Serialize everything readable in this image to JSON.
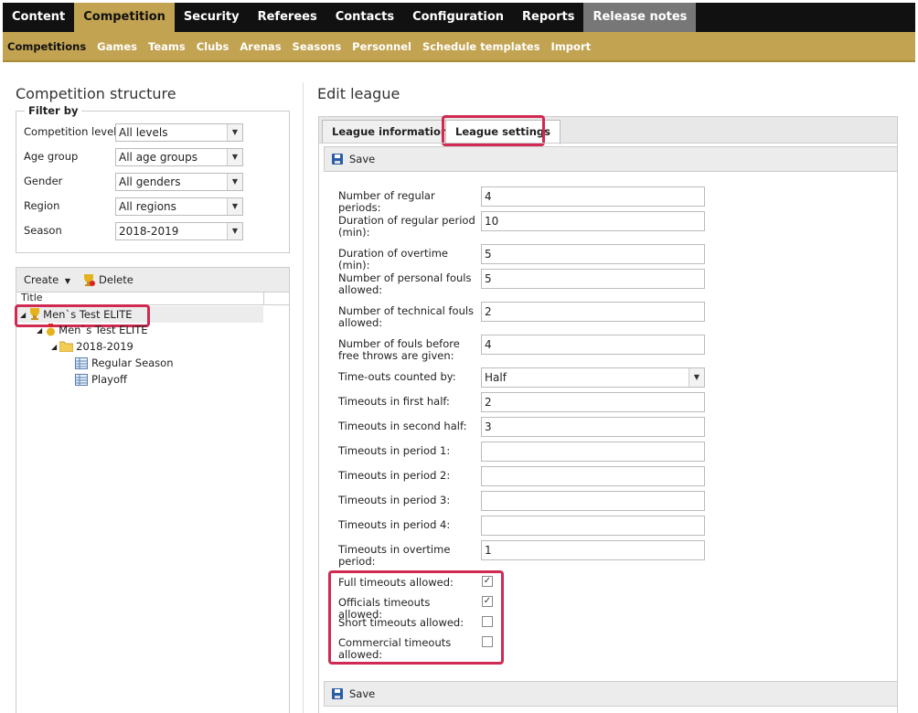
{
  "topnav": [
    "Content",
    "Competition",
    "Security",
    "Referees",
    "Contacts",
    "Configuration",
    "Reports",
    "Release notes"
  ],
  "subnav": [
    "Competitions",
    "Games",
    "Teams",
    "Clubs",
    "Arenas",
    "Seasons",
    "Personnel",
    "Schedule templates",
    "Import"
  ],
  "left": {
    "title": "Competition structure",
    "filter": {
      "legend": "Filter by",
      "rows": [
        {
          "label": "Competition level",
          "value": "All levels"
        },
        {
          "label": "Age group",
          "value": "All age groups"
        },
        {
          "label": "Gender",
          "value": "All genders"
        },
        {
          "label": "Region",
          "value": "All regions"
        },
        {
          "label": "Season",
          "value": "2018-2019"
        }
      ]
    },
    "toolbar": {
      "create": "Create",
      "delete": "Delete"
    },
    "tree_header": "Title",
    "tree": {
      "root": "Men`s Test ELITE",
      "child": "Men`s Test ELITE",
      "season": "2018-2019",
      "leaf1": "Regular Season",
      "leaf2": "Playoff"
    }
  },
  "right": {
    "title": "Edit league",
    "tabs": [
      "League information",
      "League settings"
    ],
    "save": "Save",
    "fields": [
      {
        "label": "Number of regular periods:",
        "value": "4"
      },
      {
        "label": "Duration of regular period (min):",
        "value": "10"
      },
      {
        "label": "Duration of overtime (min):",
        "value": "5"
      },
      {
        "label": "Number of personal fouls allowed:",
        "value": "5"
      },
      {
        "label": "Number of technical fouls allowed:",
        "value": "2"
      },
      {
        "label": "Number of fouls before free throws are given:",
        "value": "4"
      },
      {
        "label": "Time-outs counted by:",
        "value": "Half"
      },
      {
        "label": "Timeouts in first half:",
        "value": "2"
      },
      {
        "label": "Timeouts in second half:",
        "value": "3"
      },
      {
        "label": "Timeouts in period 1:",
        "value": ""
      },
      {
        "label": "Timeouts in period 2:",
        "value": ""
      },
      {
        "label": "Timeouts in period 3:",
        "value": ""
      },
      {
        "label": "Timeouts in period 4:",
        "value": ""
      },
      {
        "label": "Timeouts in overtime period:",
        "value": "1"
      }
    ],
    "checks": [
      {
        "label": "Full timeouts allowed:",
        "checked": "✓"
      },
      {
        "label": "Officials timeouts allowed:",
        "checked": "✓"
      },
      {
        "label": "Short timeouts allowed:",
        "checked": ""
      },
      {
        "label": "Commercial timeouts allowed:",
        "checked": ""
      }
    ]
  },
  "colors": {
    "brand": "#c2a351",
    "highlight": "#d02a52",
    "nav": "#111111"
  }
}
